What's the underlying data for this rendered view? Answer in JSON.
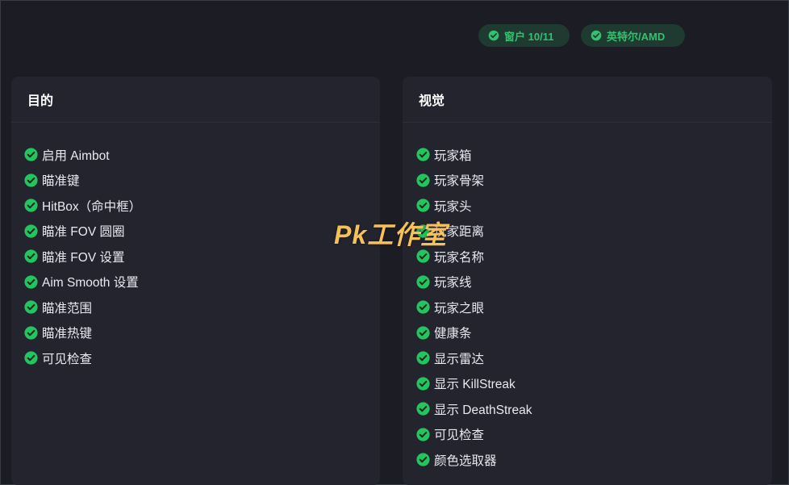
{
  "badges": [
    {
      "label": "窗户 10/11",
      "icon": "check-circle-icon"
    },
    {
      "label": "英特尔/AMD",
      "icon": "check-circle-icon"
    }
  ],
  "aim_panel": {
    "title": "目的",
    "items": [
      "启用 Aimbot",
      "瞄准键",
      "HitBox（命中框）",
      "瞄准 FOV 圆圈",
      "瞄准 FOV 设置",
      "Aim Smooth 设置",
      "瞄准范围",
      "瞄准热键",
      "可见检查"
    ]
  },
  "visual_panel": {
    "title": "视觉",
    "items": [
      "玩家箱",
      "玩家骨架",
      "玩家头",
      "玩家距离",
      "玩家名称",
      "玩家线",
      "玩家之眼",
      "健康条",
      "显示雷达",
      "显示 KillStreak",
      "显示 DeathStreak",
      "可见检查",
      "颜色选取器"
    ]
  },
  "watermark": "Pk工作室",
  "colors": {
    "accent_green": "#22c55e",
    "badge_text": "#35c06f",
    "watermark": "#f6c05a"
  }
}
